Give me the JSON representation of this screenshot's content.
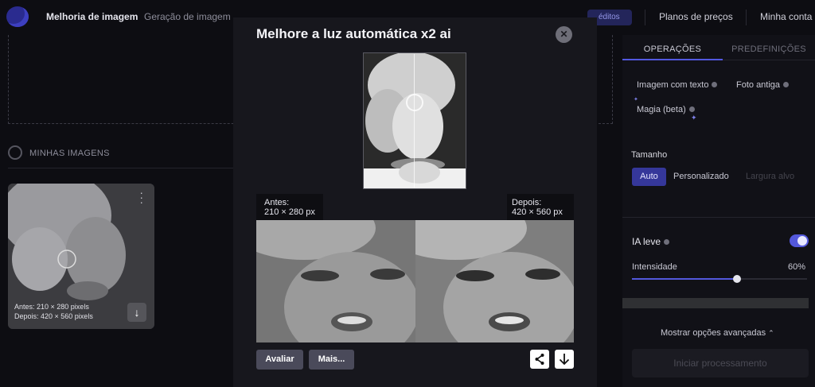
{
  "nav": {
    "enhance": "Melhoria de imagem",
    "generate": "Geração de imagem",
    "credits": "éditos",
    "plans": "Planos de preços",
    "account": "Minha conta"
  },
  "gallery": {
    "heading": "MINHAS IMAGENS",
    "card_before": "Antes:  210 × 280 pixels",
    "card_after": "Depois: 420 × 560 pixels"
  },
  "panel": {
    "tabs": [
      "OPERAÇÕES",
      "PREDEFINIÇÕES"
    ],
    "ops": [
      "Imagem com texto",
      "Foto antiga",
      "Magia (beta)"
    ],
    "size_label": "Tamanho",
    "size_auto": "Auto",
    "size_custom": "Personalizado",
    "size_width": "Largura alvo",
    "ai_label": "IA leve",
    "ai_enabled": true,
    "intensity_label": "Intensidade",
    "intensity_value": "60%",
    "intensity_fraction": 0.6,
    "advanced": "Mostrar opções avançadas",
    "start": "Iniciar processamento"
  },
  "modal": {
    "title": "Melhore a luz automática x2 ai",
    "before_label": "Antes:",
    "before_size": "210 × 280 px",
    "after_label": "Depois:",
    "after_size": "420 × 560 px",
    "rate_button": "Avaliar",
    "more_button": "Mais...",
    "icons": [
      "close-icon",
      "share-icon",
      "download-icon"
    ]
  },
  "colors": {
    "accent": "#5358dc",
    "button": "#4a4a5a",
    "background": "#0d0d12"
  }
}
